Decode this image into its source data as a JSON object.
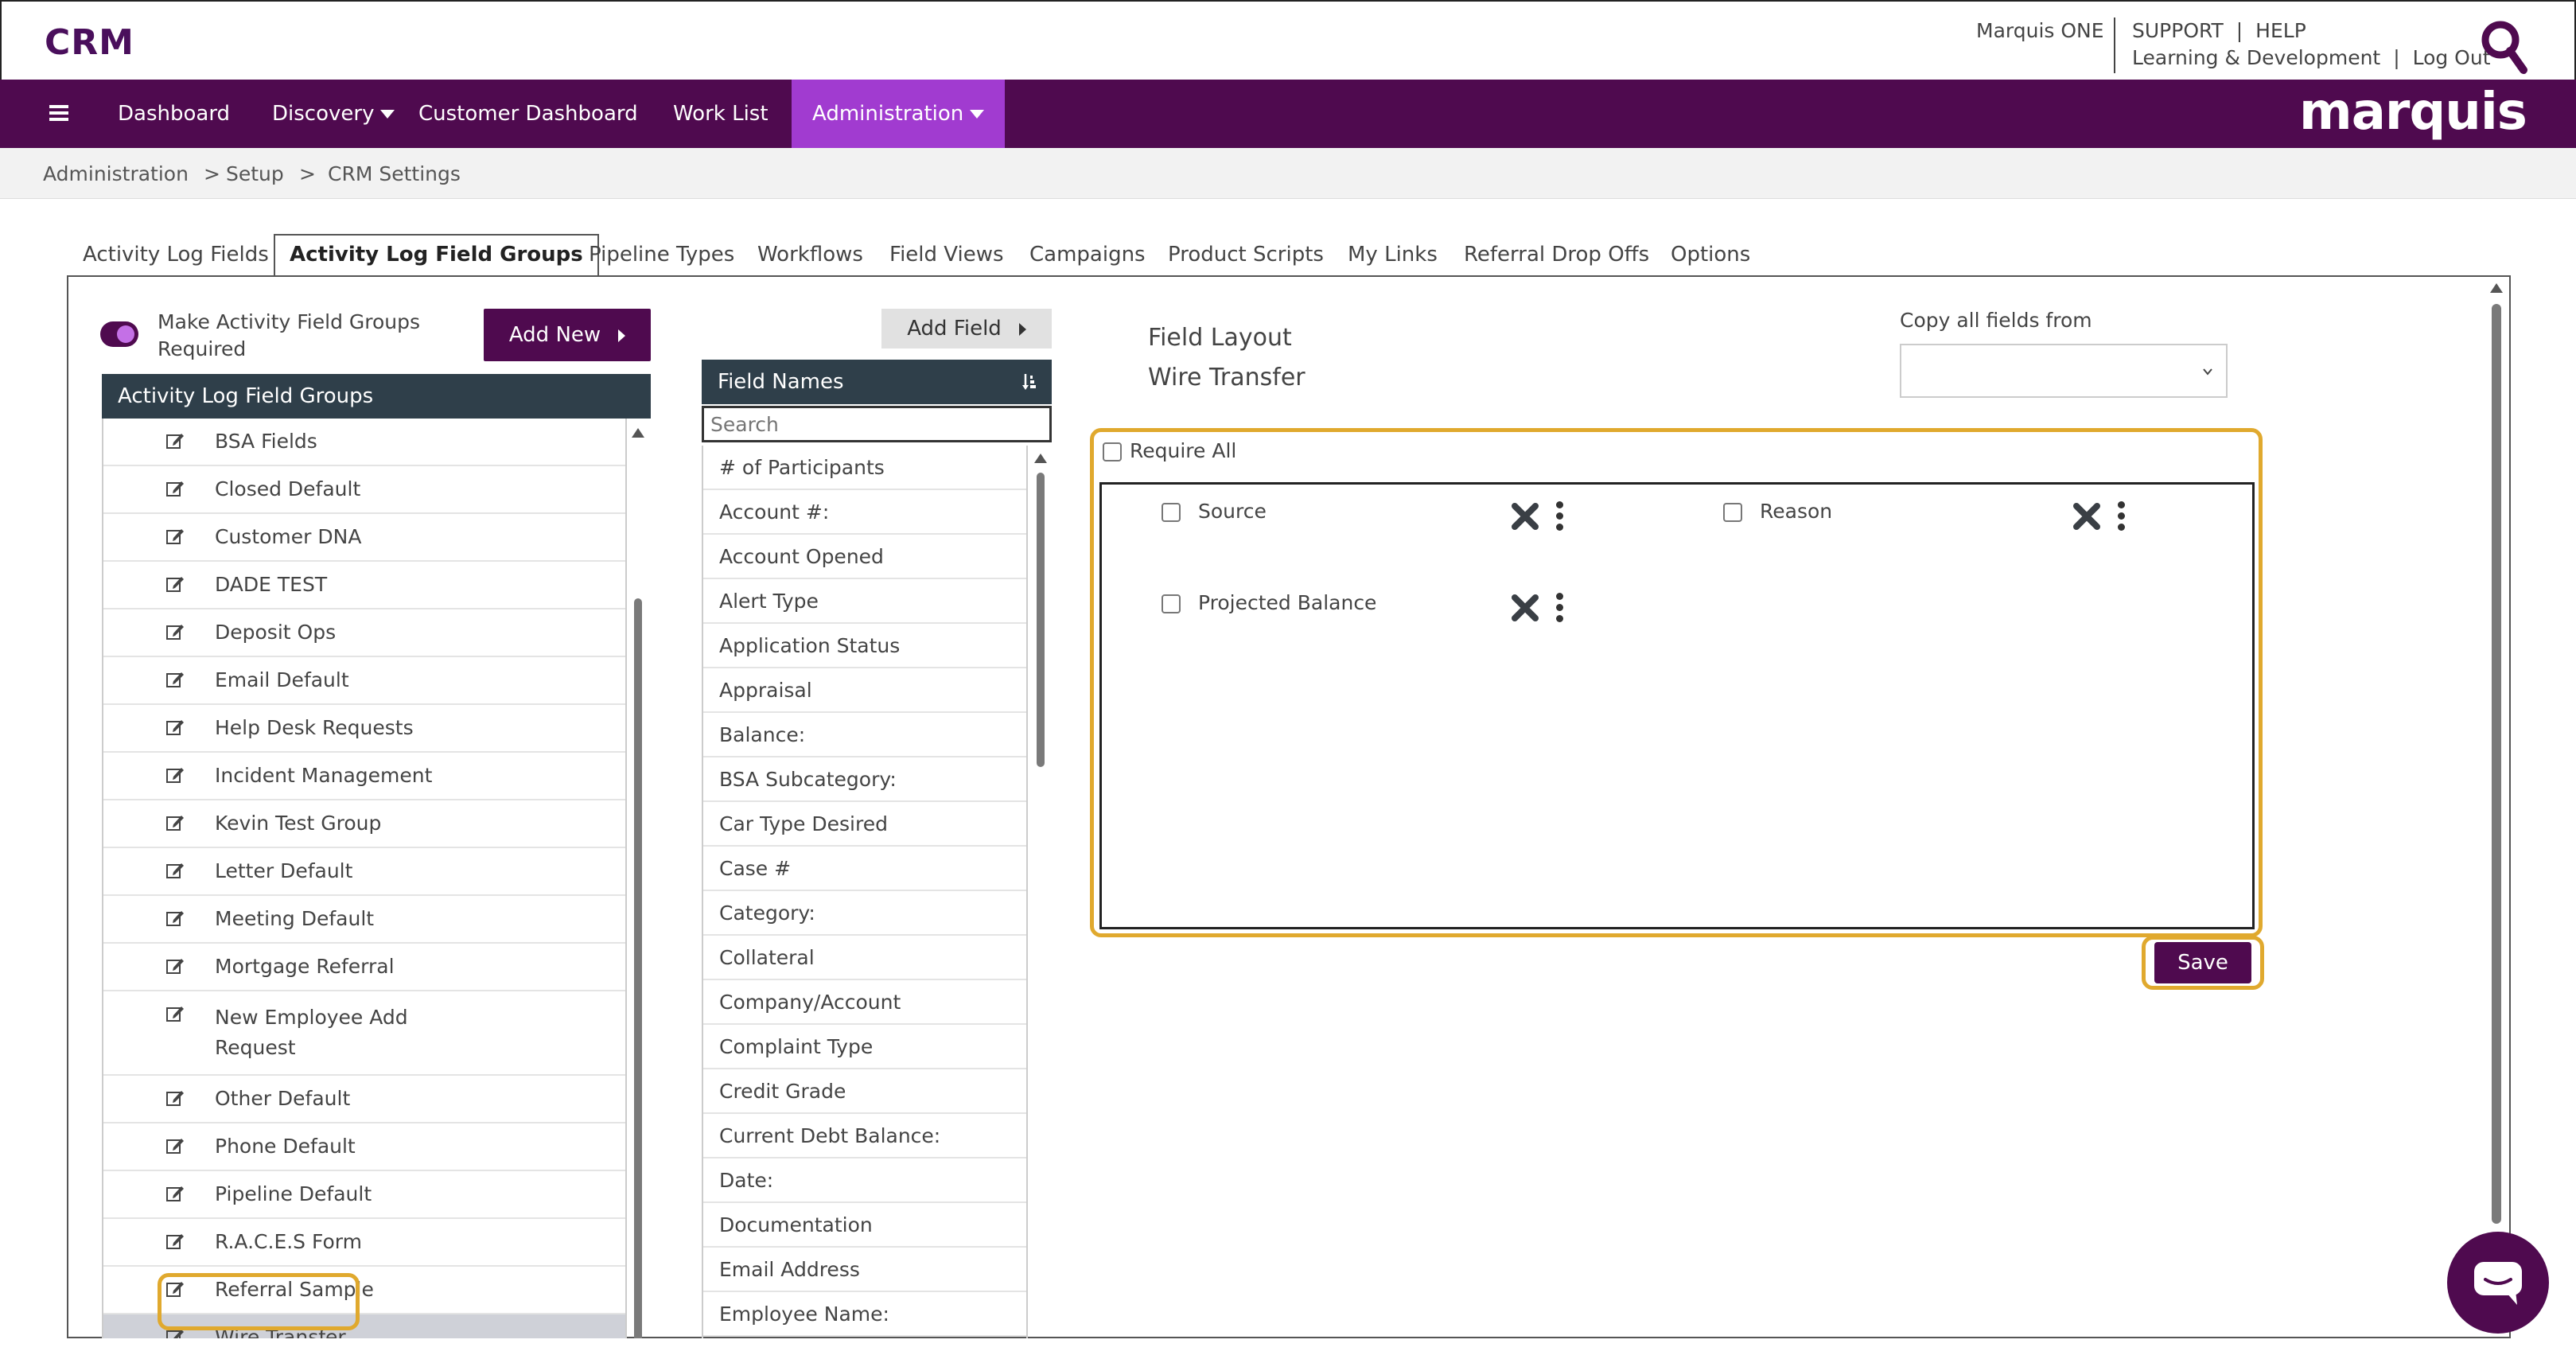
{
  "app": {
    "title": "CRM",
    "brand": "marquis"
  },
  "top_links": {
    "marquis_one": "Marquis ONE",
    "support": "SUPPORT",
    "help": "HELP",
    "learning": "Learning & Development",
    "logout": "Log Out",
    "sep": "|"
  },
  "nav": {
    "items": [
      {
        "label": "Dashboard"
      },
      {
        "label": "Discovery"
      },
      {
        "label": "Customer Dashboard"
      },
      {
        "label": "Work List"
      },
      {
        "label": "Administration"
      }
    ]
  },
  "breadcrumb": {
    "items": [
      "Administration",
      "Setup",
      "CRM Settings"
    ],
    "sep": ">"
  },
  "tabs": [
    {
      "label": "Activity Log Fields"
    },
    {
      "label": "Activity Log Field Groups",
      "active": true
    },
    {
      "label": "Pipeline Types"
    },
    {
      "label": "Workflows"
    },
    {
      "label": "Field Views"
    },
    {
      "label": "Campaigns"
    },
    {
      "label": "Product Scripts"
    },
    {
      "label": "My Links"
    },
    {
      "label": "Referral Drop Offs"
    },
    {
      "label": "Options"
    }
  ],
  "groups": {
    "toggle_label": "Make Activity Field Groups Required",
    "toggle_on": true,
    "add_new": "Add New",
    "header": "Activity Log Field Groups",
    "items": [
      "BSA Fields",
      "Closed Default",
      "Customer DNA",
      "DADE TEST",
      "Deposit Ops",
      "Email Default",
      "Help Desk Requests",
      "Incident Management",
      "Kevin Test Group",
      "Letter Default",
      "Meeting Default",
      "Mortgage Referral",
      "New Employee Add Request",
      "Other Default",
      "Phone Default",
      "Pipeline Default",
      "R.A.C.E.S Form",
      "Referral Sample",
      "Wire Transfer"
    ],
    "selected": "Wire Transfer"
  },
  "fields": {
    "add_field": "Add Field",
    "header": "Field Names",
    "search_placeholder": "Search",
    "items": [
      "# of Participants",
      "Account #:",
      "Account Opened",
      "Alert Type",
      "Application Status",
      "Appraisal",
      "Balance:",
      "BSA Subcategory:",
      "Car Type Desired",
      "Case #",
      "Category:",
      "Collateral",
      "Company/Account",
      "Complaint Type",
      "Credit Grade",
      "Current Debt Balance:",
      "Date:",
      "Documentation",
      "Email Address",
      "Employee Name:"
    ]
  },
  "layout": {
    "title": "Field Layout",
    "group_name": "Wire Transfer",
    "copy_label": "Copy all fields from",
    "copy_value": "",
    "require_all": "Require All",
    "fields": [
      {
        "label": "Source"
      },
      {
        "label": "Reason"
      },
      {
        "label": "Projected Balance"
      }
    ],
    "save": "Save"
  },
  "colors": {
    "brand_purple": "#4f0a4f",
    "active_nav": "#a13bd0",
    "highlight": "#e0a92e",
    "header_dark": "#2f3f4a"
  }
}
